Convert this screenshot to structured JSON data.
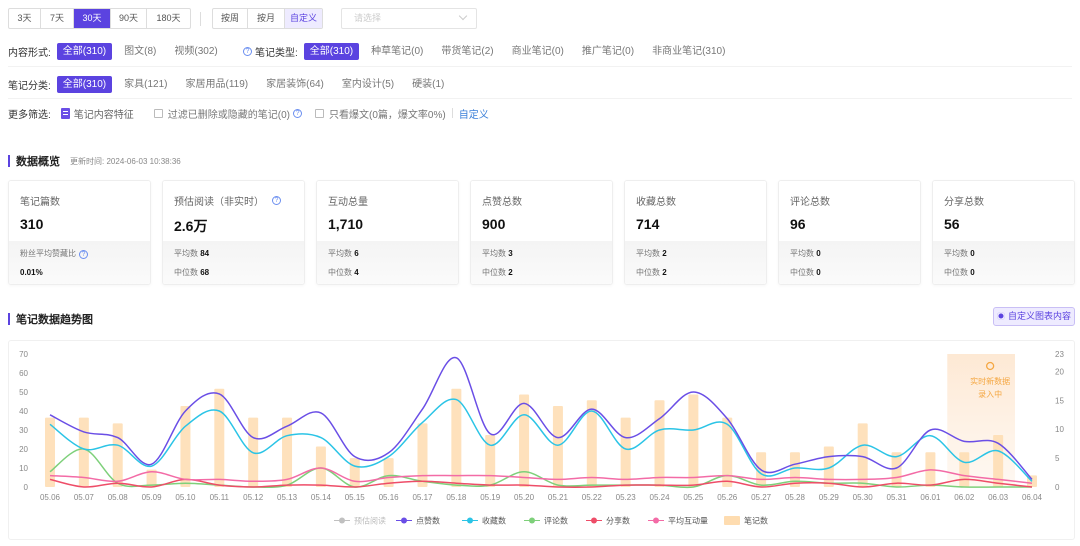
{
  "range_tabs": [
    {
      "label": "3天",
      "active": false
    },
    {
      "label": "7天",
      "active": false
    },
    {
      "label": "30天",
      "active": true
    },
    {
      "label": "90天",
      "active": false
    },
    {
      "label": "180天",
      "active": false
    }
  ],
  "period_tabs": [
    {
      "label": "按周",
      "active": false
    },
    {
      "label": "按月",
      "active": false
    },
    {
      "label": "自定义",
      "active": true
    }
  ],
  "date_select": {
    "placeholder": "请选择"
  },
  "content_form": {
    "label": "内容形式:",
    "options": [
      "全部(310)",
      "图文(8)",
      "视频(302)"
    ],
    "active_index": 0
  },
  "note_type": {
    "label": "笔记类型:",
    "options": [
      "全部(310)",
      "种草笔记(0)",
      "带货笔记(2)",
      "商业笔记(0)",
      "推广笔记(0)",
      "非商业笔记(310)"
    ],
    "active_index": 0
  },
  "note_category": {
    "label": "笔记分类:",
    "options": [
      "全部(310)",
      "家具(121)",
      "家居用品(119)",
      "家居装饰(64)",
      "室内设计(5)",
      "硬装(1)"
    ],
    "active_index": 0
  },
  "more_filters": {
    "label": "更多筛选:",
    "feature": "笔记内容特征",
    "filter_deleted": "过滤已删除或隐藏的笔记(0)",
    "only_hot": "只看爆文(0篇，爆文率0%)",
    "customize": "自定义"
  },
  "overview": {
    "title": "数据概览",
    "updated_label": "更新时间:",
    "updated_time": "2024-06-03 10:38:36"
  },
  "cards": [
    {
      "name": "笔记篇数",
      "value": "310",
      "help": false,
      "sub": [
        {
          "label": "粉丝平均赞藏比",
          "value": ""
        },
        {
          "label": "",
          "value": "0.01%"
        }
      ]
    },
    {
      "name": "预估阅读（非实时）",
      "value": "2.6万",
      "help": true,
      "sub": [
        {
          "label": "平均数",
          "value": "84"
        },
        {
          "label": "中位数",
          "value": "68"
        }
      ]
    },
    {
      "name": "互动总量",
      "value": "1,710",
      "help": false,
      "sub": [
        {
          "label": "平均数",
          "value": "6"
        },
        {
          "label": "中位数",
          "value": "4"
        }
      ]
    },
    {
      "name": "点赞总数",
      "value": "900",
      "help": false,
      "sub": [
        {
          "label": "平均数",
          "value": "3"
        },
        {
          "label": "中位数",
          "value": "2"
        }
      ]
    },
    {
      "name": "收藏总数",
      "value": "714",
      "help": false,
      "sub": [
        {
          "label": "平均数",
          "value": "2"
        },
        {
          "label": "中位数",
          "value": "2"
        }
      ]
    },
    {
      "name": "评论总数",
      "value": "96",
      "help": false,
      "sub": [
        {
          "label": "平均数",
          "value": "0"
        },
        {
          "label": "中位数",
          "value": "0"
        }
      ]
    },
    {
      "name": "分享总数",
      "value": "56",
      "help": false,
      "sub": [
        {
          "label": "平均数",
          "value": "0"
        },
        {
          "label": "中位数",
          "value": "0"
        }
      ]
    }
  ],
  "trend": {
    "title": "笔记数据趋势图",
    "custom_button": "自定义图表内容",
    "realtime_line1": "实时新数据",
    "realtime_line2": "录入中"
  },
  "chart_data": {
    "type": "line",
    "title": "笔记数据趋势图",
    "x": [
      "05.06",
      "05.07",
      "05.08",
      "05.09",
      "05.10",
      "05.11",
      "05.12",
      "05.13",
      "05.14",
      "05.15",
      "05.16",
      "05.17",
      "05.18",
      "05.19",
      "05.20",
      "05.21",
      "05.22",
      "05.23",
      "05.24",
      "05.25",
      "05.26",
      "05.27",
      "05.28",
      "05.29",
      "05.30",
      "05.31",
      "06.01",
      "06.02",
      "06.03",
      "06.04"
    ],
    "y_left": {
      "range": [
        0,
        70
      ],
      "ticks": [
        0,
        10,
        20,
        30,
        40,
        50,
        60,
        70
      ]
    },
    "y_right": {
      "range": [
        0,
        23
      ],
      "ticks": [
        0,
        5,
        10,
        15,
        20,
        23
      ]
    },
    "grid": false,
    "legend_position": "bottom",
    "highlight_range": [
      "06.02",
      "06.04"
    ],
    "series": [
      {
        "name": "预估阅读",
        "axis": "left",
        "color": "#c0c0c0",
        "visible": false,
        "values": []
      },
      {
        "name": "点赞数",
        "axis": "left",
        "color": "#6a4ee6",
        "values": [
          38,
          29,
          26,
          12,
          40,
          49,
          26,
          32,
          39,
          16,
          18,
          41,
          68,
          28,
          44,
          26,
          41,
          26,
          36,
          50,
          36,
          9,
          12,
          16,
          16,
          10,
          30,
          24,
          23,
          4
        ]
      },
      {
        "name": "收藏数",
        "axis": "left",
        "color": "#2bc4e6",
        "values": [
          33,
          20,
          22,
          11,
          32,
          40,
          18,
          27,
          26,
          11,
          16,
          34,
          46,
          22,
          38,
          22,
          40,
          20,
          30,
          30,
          33,
          7,
          10,
          10,
          22,
          16,
          27,
          13,
          19,
          3
        ]
      },
      {
        "name": "评论数",
        "axis": "left",
        "color": "#7ed07a",
        "values": [
          8,
          20,
          2,
          1,
          2,
          1,
          0,
          1,
          10,
          0,
          6,
          3,
          1,
          1,
          8,
          1,
          1,
          1,
          1,
          0,
          6,
          1,
          3,
          2,
          2,
          0,
          1,
          0,
          0,
          0
        ]
      },
      {
        "name": "分享数",
        "axis": "left",
        "color": "#ee4d68",
        "values": [
          4,
          0,
          2,
          0,
          4,
          1,
          0,
          1,
          1,
          0,
          2,
          3,
          2,
          1,
          1,
          0,
          0,
          1,
          1,
          1,
          3,
          0,
          2,
          2,
          0,
          2,
          1,
          4,
          2,
          0
        ]
      },
      {
        "name": "平均互动量",
        "axis": "left",
        "color": "#f36ba6",
        "values": [
          6,
          5,
          3,
          8,
          4,
          4,
          3,
          4,
          10,
          3,
          5,
          6,
          6,
          6,
          5,
          4,
          5,
          4,
          5,
          5,
          6,
          4,
          5,
          4,
          4,
          5,
          9,
          6,
          4,
          2
        ]
      },
      {
        "name": "笔记数",
        "axis": "right",
        "color": "#fedcb0",
        "type": "bar",
        "values": [
          12,
          12,
          11,
          3,
          14,
          17,
          12,
          12,
          7,
          5,
          5,
          11,
          17,
          9,
          16,
          14,
          15,
          12,
          15,
          16,
          12,
          6,
          6,
          7,
          11,
          6,
          6,
          6,
          9,
          2
        ]
      }
    ]
  }
}
